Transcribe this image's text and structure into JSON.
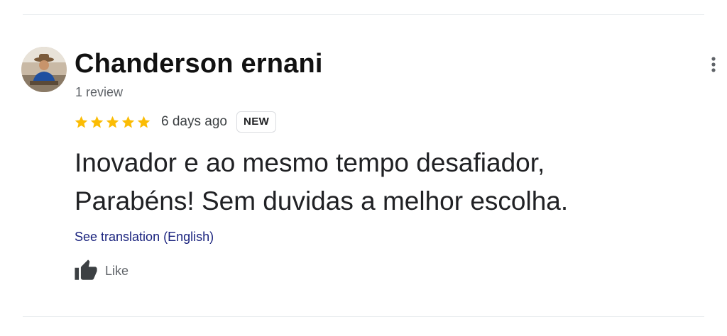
{
  "review": {
    "reviewer_name": "Chanderson ernani",
    "review_count": "1 review",
    "rating": 5,
    "rating_max": 5,
    "date": "6 days ago",
    "badge": "NEW",
    "text_lines": [
      "Inovador e ao mesmo tempo desafiador,",
      "Parabéns! Sem duvidas a melhor escolha."
    ],
    "translation_link": "See translation (English)",
    "like_label": "Like"
  },
  "icons": {
    "star": "star-icon",
    "menu": "more-vert-icon",
    "like": "thumb-up-icon",
    "avatar": "avatar"
  },
  "colors": {
    "star": "#fbbc04",
    "link": "#1a237e",
    "secondary_text": "#5f6368"
  }
}
